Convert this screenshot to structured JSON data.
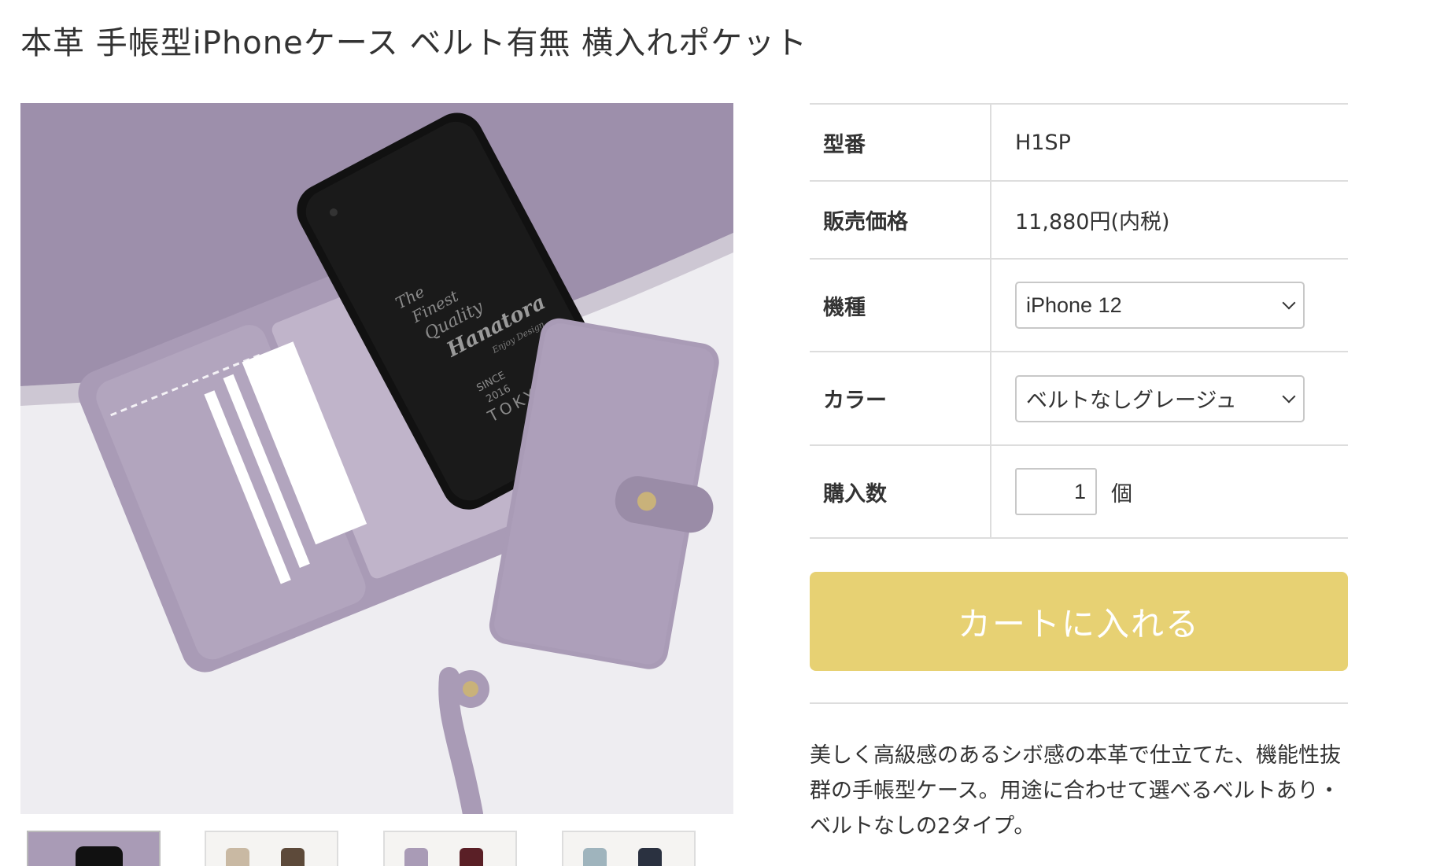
{
  "page": {
    "title": "本革 手帳型iPhoneケース ベルト有無 横入れポケット"
  },
  "product_image": {
    "alt": "lavender leather notebook-style iPhone case",
    "case_print": {
      "line1": "The",
      "line2": "Finest",
      "line3": "Quality",
      "brand": "Hanatora",
      "tagline": "Enjoy Design",
      "since": "SINCE",
      "year": "2016",
      "city": "TOKYO"
    },
    "colors": {
      "leather": "#a99bb6",
      "leather_dark": "#8f819c",
      "background_top": "#9d8fab",
      "table_white": "#eeedf1",
      "phone": "#111111",
      "button_metal": "#c9b27a"
    }
  },
  "thumbnails": [
    {
      "name": "thumb-lavender",
      "colors": [
        "#a99bb6",
        "#111111"
      ]
    },
    {
      "name": "thumb-greige-brown",
      "colors": [
        "#c9b9a3",
        "#5d4a3a"
      ]
    },
    {
      "name": "thumb-lavender-burgundy",
      "colors": [
        "#a99bb6",
        "#5a1f26"
      ]
    },
    {
      "name": "thumb-blue-navy",
      "colors": [
        "#9fb4bd",
        "#2a3140"
      ]
    }
  ],
  "spec": {
    "model_label": "型番",
    "model_value": "H1SP",
    "price_label": "販売価格",
    "price_value": "11,880円(内税)",
    "device_label": "機種",
    "device_selected": "iPhone 12",
    "color_label": "カラー",
    "color_selected": "ベルトなしグレージュ",
    "quantity_label": "購入数",
    "quantity_value": "1",
    "quantity_unit": "個"
  },
  "cart": {
    "button_label": "カートに入れる",
    "button_color": "#e7d173"
  },
  "description": {
    "text": "美しく高級感のあるシボ感の本革で仕立てた、機能性抜群の手帳型ケース。用途に合わせて選べるベルトあり・ベルトなしの2タイプ。"
  }
}
